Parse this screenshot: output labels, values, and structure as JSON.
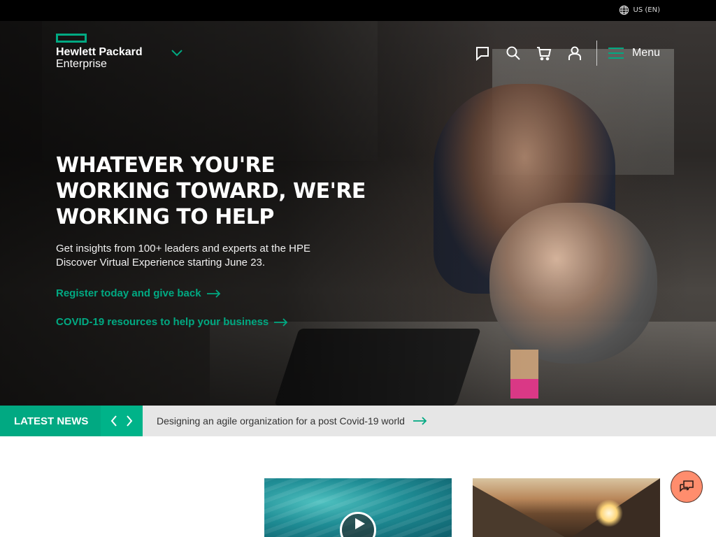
{
  "topbar": {
    "locale": "US (EN)"
  },
  "brand": {
    "line1": "Hewlett Packard",
    "line2": "Enterprise",
    "accent": "#01a982"
  },
  "nav": {
    "menu_label": "Menu",
    "icons": [
      "chat-icon",
      "search-icon",
      "cart-icon",
      "user-icon",
      "hamburger-icon"
    ]
  },
  "hero": {
    "headline_lines": [
      "WHATEVER YOU'RE",
      "WORKING TOWARD, WE'RE",
      "WORKING TO HELP"
    ],
    "subtext_lines": [
      "Get insights from 100+ leaders and experts at the HPE",
      "Discover Virtual Experience starting June 23."
    ],
    "cta_primary": "Register today and give back",
    "cta_secondary": "COVID-19 resources to help your business"
  },
  "news": {
    "label": "LATEST NEWS",
    "headline": "Designing an agile organization for a post Covid-19 world"
  },
  "cards": [
    {
      "image": "ocean-water",
      "has_play_icon": true
    },
    {
      "image": "mountain-sunset",
      "has_play_icon": false
    }
  ]
}
